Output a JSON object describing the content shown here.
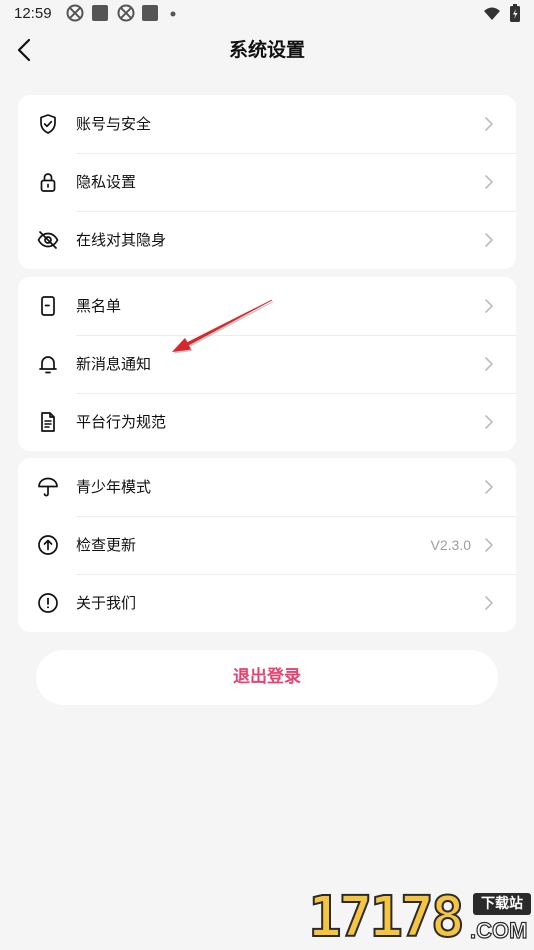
{
  "status_bar": {
    "time": "12:59",
    "left_icons": [
      "pinwheel-icon",
      "square-app-icon",
      "pinwheel-icon",
      "square-app-icon",
      "dot-icon"
    ],
    "right_icons": [
      "wifi-icon",
      "battery-icon"
    ]
  },
  "header": {
    "title": "系统设置",
    "back_icon": "chevron-left-icon"
  },
  "groups": [
    {
      "items": [
        {
          "label": "账号与安全",
          "icon": "shield-check-icon"
        },
        {
          "label": "隐私设置",
          "icon": "lock-icon"
        },
        {
          "label": "在线对其隐身",
          "icon": "eye-off-icon"
        }
      ]
    },
    {
      "items": [
        {
          "label": "黑名单",
          "icon": "document-icon"
        },
        {
          "label": "新消息通知",
          "icon": "bell-icon"
        },
        {
          "label": "平台行为规范",
          "icon": "file-text-icon"
        }
      ]
    },
    {
      "items": [
        {
          "label": "青少年模式",
          "icon": "umbrella-icon"
        },
        {
          "label": "检查更新",
          "icon": "arrow-up-circle-icon",
          "value": "V2.3.0"
        },
        {
          "label": "关于我们",
          "icon": "exclamation-circle-icon"
        }
      ]
    }
  ],
  "row_chevron_icon": "chevron-right-icon",
  "logout": {
    "label": "退出登录"
  },
  "annotation": {
    "icon": "red-arrow-icon"
  },
  "watermark": {
    "number": "17178",
    "badge": "下载站",
    "domain": ".COM"
  },
  "colors": {
    "background": "#f5f5f5",
    "card": "#ffffff",
    "accent": "#e8436f",
    "divider": "#ececec",
    "chevron": "#bdbdbd",
    "secondary_text": "#9e9e9e",
    "annotation": "#d9262c",
    "watermark": "#f5c542"
  }
}
